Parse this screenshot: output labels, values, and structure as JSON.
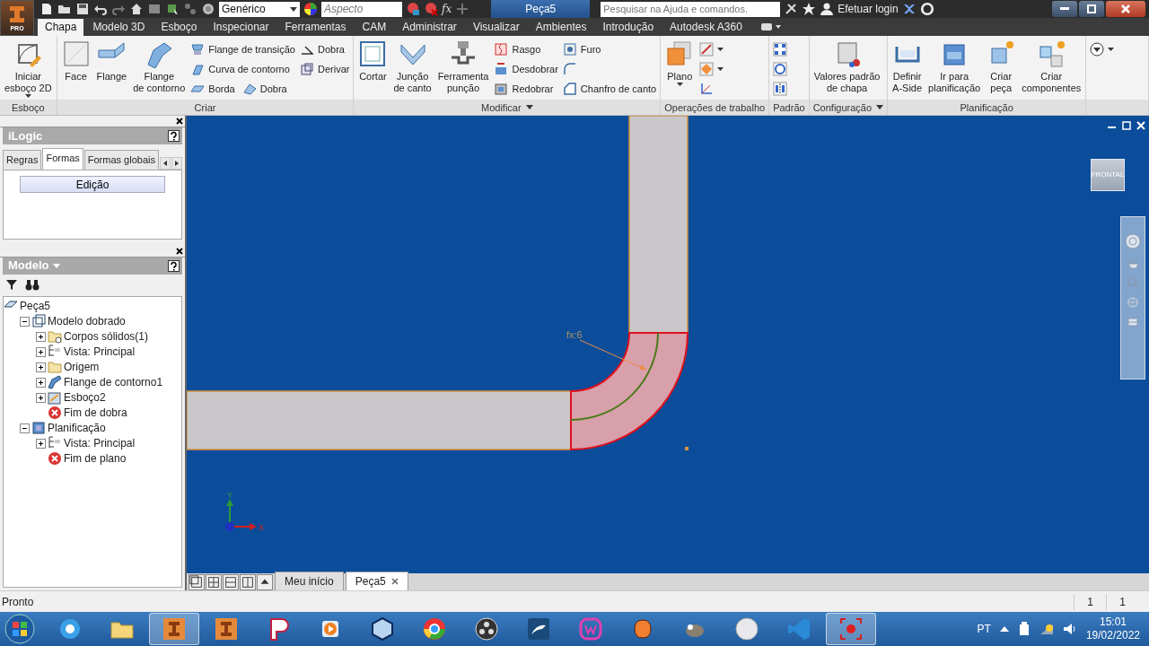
{
  "title_bar": {
    "app_badge": "PRO",
    "style_value": "Genérico",
    "appearance_placeholder": "Aspecto",
    "formula_button": "fx",
    "document_title": "Peça5",
    "search_placeholder": "Pesquisar na Ajuda e comandos.",
    "login": "Efetuar login"
  },
  "ribbon_tabs": [
    {
      "label": "Chapa",
      "selected": true
    },
    {
      "label": "Modelo 3D",
      "selected": false
    },
    {
      "label": "Esboço",
      "selected": false
    },
    {
      "label": "Inspecionar",
      "selected": false
    },
    {
      "label": "Ferramentas",
      "selected": false
    },
    {
      "label": "CAM",
      "selected": false
    },
    {
      "label": "Administrar",
      "selected": false
    },
    {
      "label": "Visualizar",
      "selected": false
    },
    {
      "label": "Ambientes",
      "selected": false
    },
    {
      "label": "Introdução",
      "selected": false
    },
    {
      "label": "Autodesk A360",
      "selected": false
    }
  ],
  "ribbon_panels": [
    {
      "title": "Esboço",
      "dropdown": false,
      "columns": [
        {
          "kind": "large",
          "label": "Iniciar\nesboço 2D",
          "dropdown": true
        }
      ]
    },
    {
      "title": "Criar",
      "dropdown": false,
      "columns": [
        {
          "kind": "large",
          "label": "Face"
        },
        {
          "kind": "large",
          "label": "Flange"
        },
        {
          "kind": "large",
          "label": "Flange\nde contorno"
        },
        {
          "kind": "stack",
          "rows": [
            [
              {
                "label": "Flange de transição"
              }
            ],
            [
              {
                "label": "Curva de contorno"
              }
            ],
            [
              {
                "label": "Borda"
              },
              {
                "label": "Dobra"
              }
            ]
          ]
        },
        {
          "kind": "stack",
          "rows": [
            [
              {
                "label": "Dobra"
              }
            ],
            [
              {
                "label": "Derivar"
              }
            ]
          ]
        }
      ]
    },
    {
      "title": "Modificar",
      "dropdown": true,
      "columns": [
        {
          "kind": "large",
          "label": "Cortar"
        },
        {
          "kind": "large",
          "label": "Junção\nde canto"
        },
        {
          "kind": "large",
          "label": "Ferramenta\npunção"
        },
        {
          "kind": "stack",
          "rows": [
            [
              {
                "label": "Rasgo"
              }
            ],
            [
              {
                "label": "Desdobrar"
              }
            ],
            [
              {
                "label": "Redobrar"
              }
            ]
          ]
        },
        {
          "kind": "stack",
          "rows": [
            [
              {
                "label": "Furo"
              }
            ],
            [
              {
                "dropdown": false
              }
            ],
            [
              {
                "label": "Chanfro de canto"
              }
            ]
          ]
        }
      ]
    },
    {
      "title": "Operações de trabalho",
      "dropdown": false,
      "columns": [
        {
          "kind": "large",
          "label": "Plano",
          "dropdown": true
        },
        {
          "kind": "stack",
          "rows": [
            [
              {
                "dropdown": true
              }
            ],
            [
              {
                "dropdown": true
              }
            ],
            [
              {
                "dropdown": false
              }
            ]
          ]
        }
      ]
    },
    {
      "title": "Padrão",
      "dropdown": false,
      "columns": [
        {
          "kind": "stack",
          "rows": [
            [
              {
                "dropdown": false
              }
            ],
            [
              {
                "dropdown": false
              }
            ],
            [
              {
                "dropdown": false
              }
            ]
          ]
        }
      ]
    },
    {
      "title": "Configuração",
      "dropdown": true,
      "columns": [
        {
          "kind": "large",
          "label": "Valores padrão\nde chapa"
        }
      ]
    },
    {
      "title": "Planificação",
      "dropdown": false,
      "columns": [
        {
          "kind": "large",
          "label": "Definir\nA-Side"
        },
        {
          "kind": "large",
          "label": "Ir para\nplanificação"
        },
        {
          "kind": "large",
          "label": "Criar\npeça"
        },
        {
          "kind": "large",
          "label": "Criar\ncomponentes"
        }
      ]
    },
    {
      "dropdown": false,
      "columns": [
        {
          "kind": "stack",
          "rows": [
            [
              {
                "dropdown": true
              }
            ]
          ]
        }
      ]
    }
  ],
  "ilogic_panel": {
    "title": "iLogic",
    "tabs": [
      {
        "label": "Regras",
        "selected": false
      },
      {
        "label": "Formas",
        "selected": true
      },
      {
        "label": "Formas globais",
        "selected": false
      }
    ],
    "button": "Edição"
  },
  "model_panel": {
    "title": "Modelo",
    "tree": [
      {
        "label": "Peça5",
        "children": [
          {
            "label": "Modelo dobrado",
            "expanded": true,
            "children": [
              {
                "label": "Corpos sólidos(1)",
                "expanded": false
              },
              {
                "label": "Vista: Principal",
                "expanded": false
              },
              {
                "label": "Origem",
                "expanded": false
              },
              {
                "label": "Flange de contorno1",
                "expanded": false
              },
              {
                "label": "Esboço2",
                "expanded": false
              },
              {
                "label": "Fim de dobra"
              }
            ]
          },
          {
            "label": "Planificação",
            "expanded": true,
            "children": [
              {
                "label": "Vista: Principal",
                "expanded": false
              },
              {
                "label": "Fim de plano"
              }
            ]
          }
        ]
      }
    ]
  },
  "canvas": {
    "annotation": "fx:6",
    "view_cube": "FRONTAL",
    "y_axis_label": "Y",
    "x_axis_label": "X"
  },
  "document_tabs": [
    {
      "label": "Meu início",
      "selected": false
    },
    {
      "label": "Peça5",
      "selected": true
    }
  ],
  "status_bar": {
    "message": "Pronto",
    "fields": [
      "1",
      "1"
    ]
  },
  "taskbar": {
    "apps": [
      {
        "active": false
      },
      {
        "active": false
      },
      {
        "active": true
      },
      {
        "active": false
      },
      {
        "active": false
      },
      {
        "active": false
      },
      {
        "active": false
      },
      {
        "active": false
      },
      {
        "active": false
      },
      {
        "active": false
      },
      {
        "active": false
      },
      {
        "active": false
      },
      {
        "active": false
      },
      {
        "active": false
      },
      {
        "active": false
      },
      {
        "active": true
      }
    ],
    "language": "PT",
    "time": "15:01",
    "date": "19/02/2022"
  }
}
